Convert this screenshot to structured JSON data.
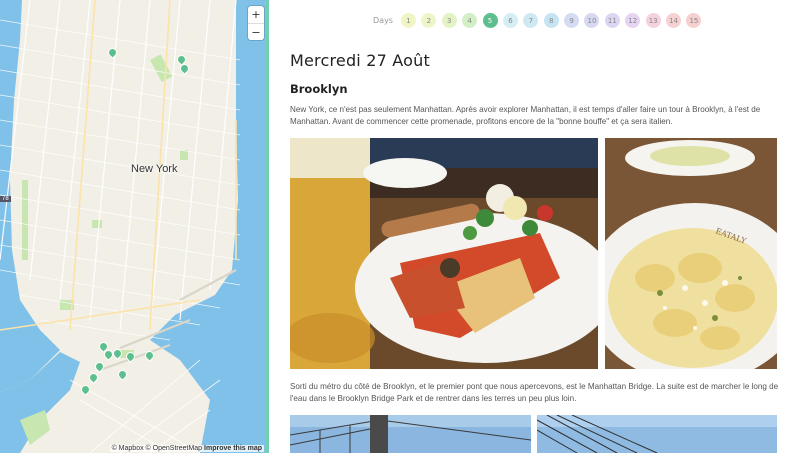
{
  "map": {
    "zoom_in": "+",
    "zoom_out": "−",
    "city_label": "New York",
    "highway_badge": "78",
    "attribution": {
      "mapbox": "© Mapbox",
      "osm": "© OpenStreetMap",
      "improve": "Improve this map"
    },
    "colors": {
      "water": "#7fc1e8",
      "land": "#f2efe6",
      "park": "#c8e6b0",
      "border": "#6fd0b2"
    }
  },
  "days": {
    "label": "Days",
    "items": [
      {
        "n": "1",
        "color": "#f1f5c6"
      },
      {
        "n": "2",
        "color": "#eef6c9"
      },
      {
        "n": "3",
        "color": "#e3f3c6"
      },
      {
        "n": "4",
        "color": "#d4efc5"
      },
      {
        "n": "5",
        "color": "#5dbf8e",
        "active": true
      },
      {
        "n": "6",
        "color": "#d5eef4"
      },
      {
        "n": "7",
        "color": "#cfe9f4"
      },
      {
        "n": "8",
        "color": "#c6e4f2"
      },
      {
        "n": "9",
        "color": "#d3dcf0"
      },
      {
        "n": "10",
        "color": "#d7d9f0"
      },
      {
        "n": "11",
        "color": "#ddd6f2"
      },
      {
        "n": "12",
        "color": "#e6d5f2"
      },
      {
        "n": "13",
        "color": "#f4d1dc"
      },
      {
        "n": "14",
        "color": "#f6d1d4"
      },
      {
        "n": "15",
        "color": "#f6d0d0"
      }
    ]
  },
  "article": {
    "title": "Mercredi 27 Août",
    "section": "Brooklyn",
    "paragraph1": "New York, ce n'est pas seulement Manhattan. Après avoir explorer Manhattan, il est temps d'aller faire un tour à Brooklyn, à l'est de Manhattan. Avant de commencer cette promenade, profitons encore de la \"bonne bouffe\" et ça sera italien.",
    "paragraph2": "Sorti du métro du côté de Brooklyn, et le premier pont que nous apercevons, est le Manhattan Bridge. La suite est de marcher le long de l'eau dans le Brooklyn Bridge Park et de rentrer dans les terres un peu plus loin."
  }
}
